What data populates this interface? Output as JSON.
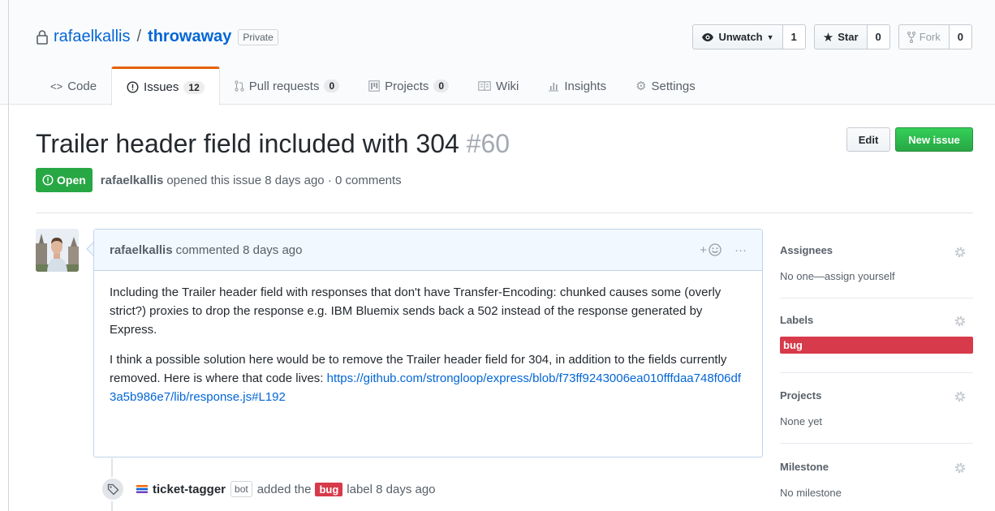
{
  "repo": {
    "owner": "rafaelkallis",
    "separator": "/",
    "name": "throwaway",
    "visibility": "Private"
  },
  "head_actions": {
    "watch": {
      "label": "Unwatch",
      "count": "1",
      "icon": "eye-icon"
    },
    "star": {
      "label": "Star",
      "count": "0",
      "icon": "star-icon"
    },
    "fork": {
      "label": "Fork",
      "count": "0",
      "icon": "fork-icon"
    }
  },
  "tabs": [
    {
      "label": "Code",
      "icon": "code-icon"
    },
    {
      "label": "Issues",
      "counter": "12",
      "icon": "issue-opened-icon",
      "selected": true
    },
    {
      "label": "Pull requests",
      "counter": "0",
      "icon": "pull-request-icon"
    },
    {
      "label": "Projects",
      "counter": "0",
      "icon": "project-icon"
    },
    {
      "label": "Wiki",
      "icon": "book-icon"
    },
    {
      "label": "Insights",
      "icon": "graph-icon"
    },
    {
      "label": "Settings",
      "icon": "gear-icon"
    }
  ],
  "issue": {
    "title": "Trailer header field included with 304",
    "number": "#60",
    "state": "Open",
    "author": "rafaelkallis",
    "meta_text": "opened this issue 8 days ago · 0 comments",
    "edit_label": "Edit",
    "new_issue_label": "New issue"
  },
  "comment": {
    "author": "rafaelkallis",
    "action": "commented 8 days ago",
    "reaction": "+",
    "more": "···",
    "paragraph1": "Including the Trailer header field with responses that don't have Transfer-Encoding: chunked causes some (overly strict?) proxies to drop the response e.g. IBM Bluemix sends back a 502 instead of the response generated by Express.",
    "paragraph2": "I think a possible solution here would be to remove the Trailer header field for 304, in addition to the fields currently removed. Here is where that code lives:",
    "link": "https://github.com/strongloop/express/blob/f73ff9243006ea010fffdaa748f06df3a5b986e7/lib/response.js#L192"
  },
  "timeline": {
    "actor": "ticket-tagger",
    "bot": "bot",
    "action": "added the",
    "label": "bug",
    "suffix": "label 8 days ago"
  },
  "sidebar": {
    "assignees": {
      "heading": "Assignees",
      "value": "No one—assign yourself"
    },
    "labels": {
      "heading": "Labels",
      "value": "bug",
      "color": "#d73a4a"
    },
    "projects": {
      "heading": "Projects",
      "value": "None yet"
    },
    "milestone": {
      "heading": "Milestone",
      "value": "No milestone"
    }
  },
  "colors": {
    "accent": "#0366d6",
    "open": "#28a745",
    "bug": "#d73a4a",
    "tab_highlight": "#e36209"
  }
}
